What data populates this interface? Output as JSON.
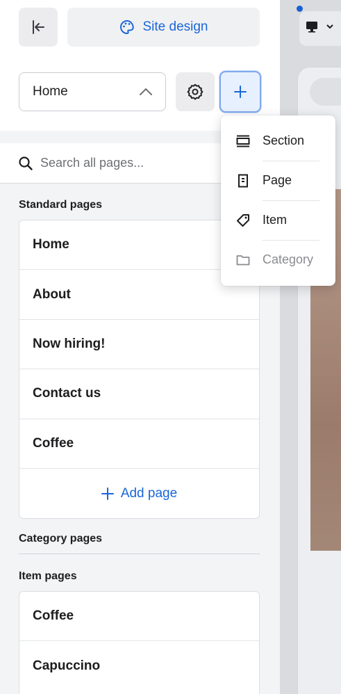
{
  "header": {
    "site_design_label": "Site design"
  },
  "page_selector": {
    "value": "Home"
  },
  "search": {
    "placeholder": "Search all pages..."
  },
  "standard_pages": {
    "label": "Standard pages",
    "items": [
      "Home",
      "About",
      "Now hiring!",
      "Contact us",
      "Coffee"
    ],
    "add_label": "Add page"
  },
  "category_pages": {
    "label": "Category pages"
  },
  "item_pages": {
    "label": "Item pages",
    "items": [
      "Coffee",
      "Capuccino"
    ]
  },
  "add_menu": {
    "items": [
      {
        "label": "Section",
        "icon": "section-icon"
      },
      {
        "label": "Page",
        "icon": "page-icon"
      },
      {
        "label": "Item",
        "icon": "tag-icon"
      },
      {
        "label": "Category",
        "icon": "folder-icon",
        "disabled": true
      }
    ]
  },
  "colors": {
    "accent": "#1a66d9",
    "panel_bg": "#f3f4f6"
  }
}
